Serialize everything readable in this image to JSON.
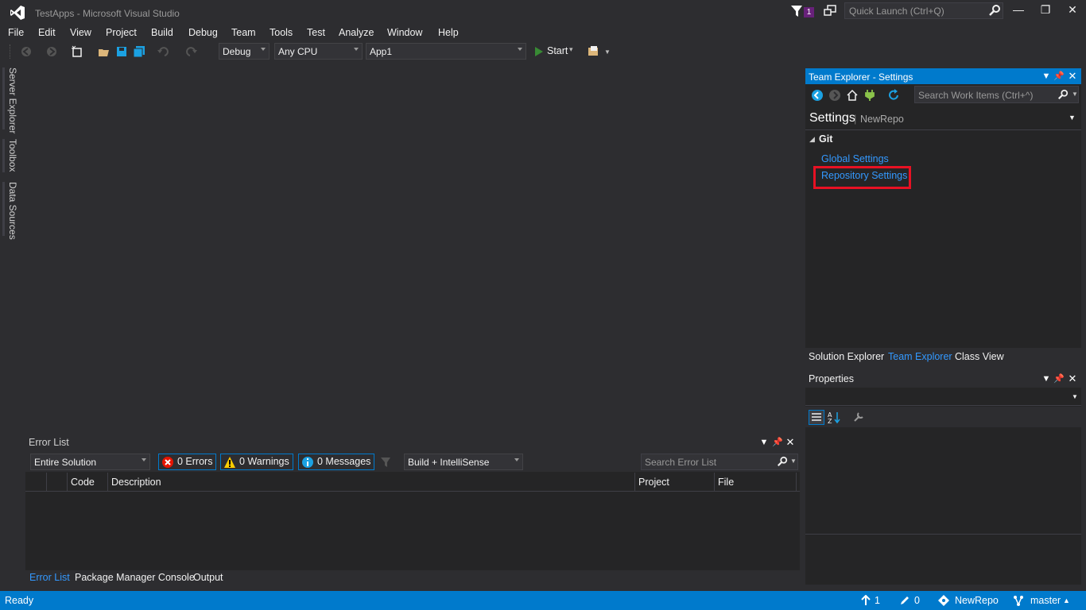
{
  "window": {
    "title": "TestApps - Microsoft Visual Studio",
    "notification_count": "1",
    "quick_launch_placeholder": "Quick Launch (Ctrl+Q)"
  },
  "menu": [
    "File",
    "Edit",
    "View",
    "Project",
    "Build",
    "Debug",
    "Team",
    "Tools",
    "Test",
    "Analyze",
    "Window",
    "Help"
  ],
  "toolbar": {
    "configuration": "Debug",
    "platform": "Any CPU",
    "startup_project": "App1",
    "start_label": "Start"
  },
  "left_tabs": [
    "Server Explorer",
    "Toolbox",
    "Data Sources"
  ],
  "team_explorer": {
    "title": "Team Explorer - Settings",
    "search_placeholder": "Search Work Items (Ctrl+^)",
    "page_title": "Settings",
    "repo_name": "NewRepo",
    "section": "Git",
    "links": [
      "Global Settings",
      "Repository Settings"
    ],
    "highlight_color": "#e81123"
  },
  "right_tabs": [
    "Solution Explorer",
    "Team Explorer",
    "Class View"
  ],
  "properties": {
    "title": "Properties"
  },
  "error_list": {
    "title": "Error List",
    "scope": "Entire Solution",
    "errors": "0 Errors",
    "warnings": "0 Warnings",
    "messages": "0 Messages",
    "source": "Build + IntelliSense",
    "search_placeholder": "Search Error List",
    "columns": [
      "Code",
      "Description",
      "Project",
      "File"
    ]
  },
  "bottom_tabs": [
    "Error List",
    "Package Manager Console",
    "Output"
  ],
  "status": {
    "ready": "Ready",
    "push_count": "1",
    "pending_changes": "0",
    "repo": "NewRepo",
    "branch": "master"
  },
  "colors": {
    "accent": "#007acc",
    "background": "#2d2d30",
    "link": "#3399ff"
  }
}
